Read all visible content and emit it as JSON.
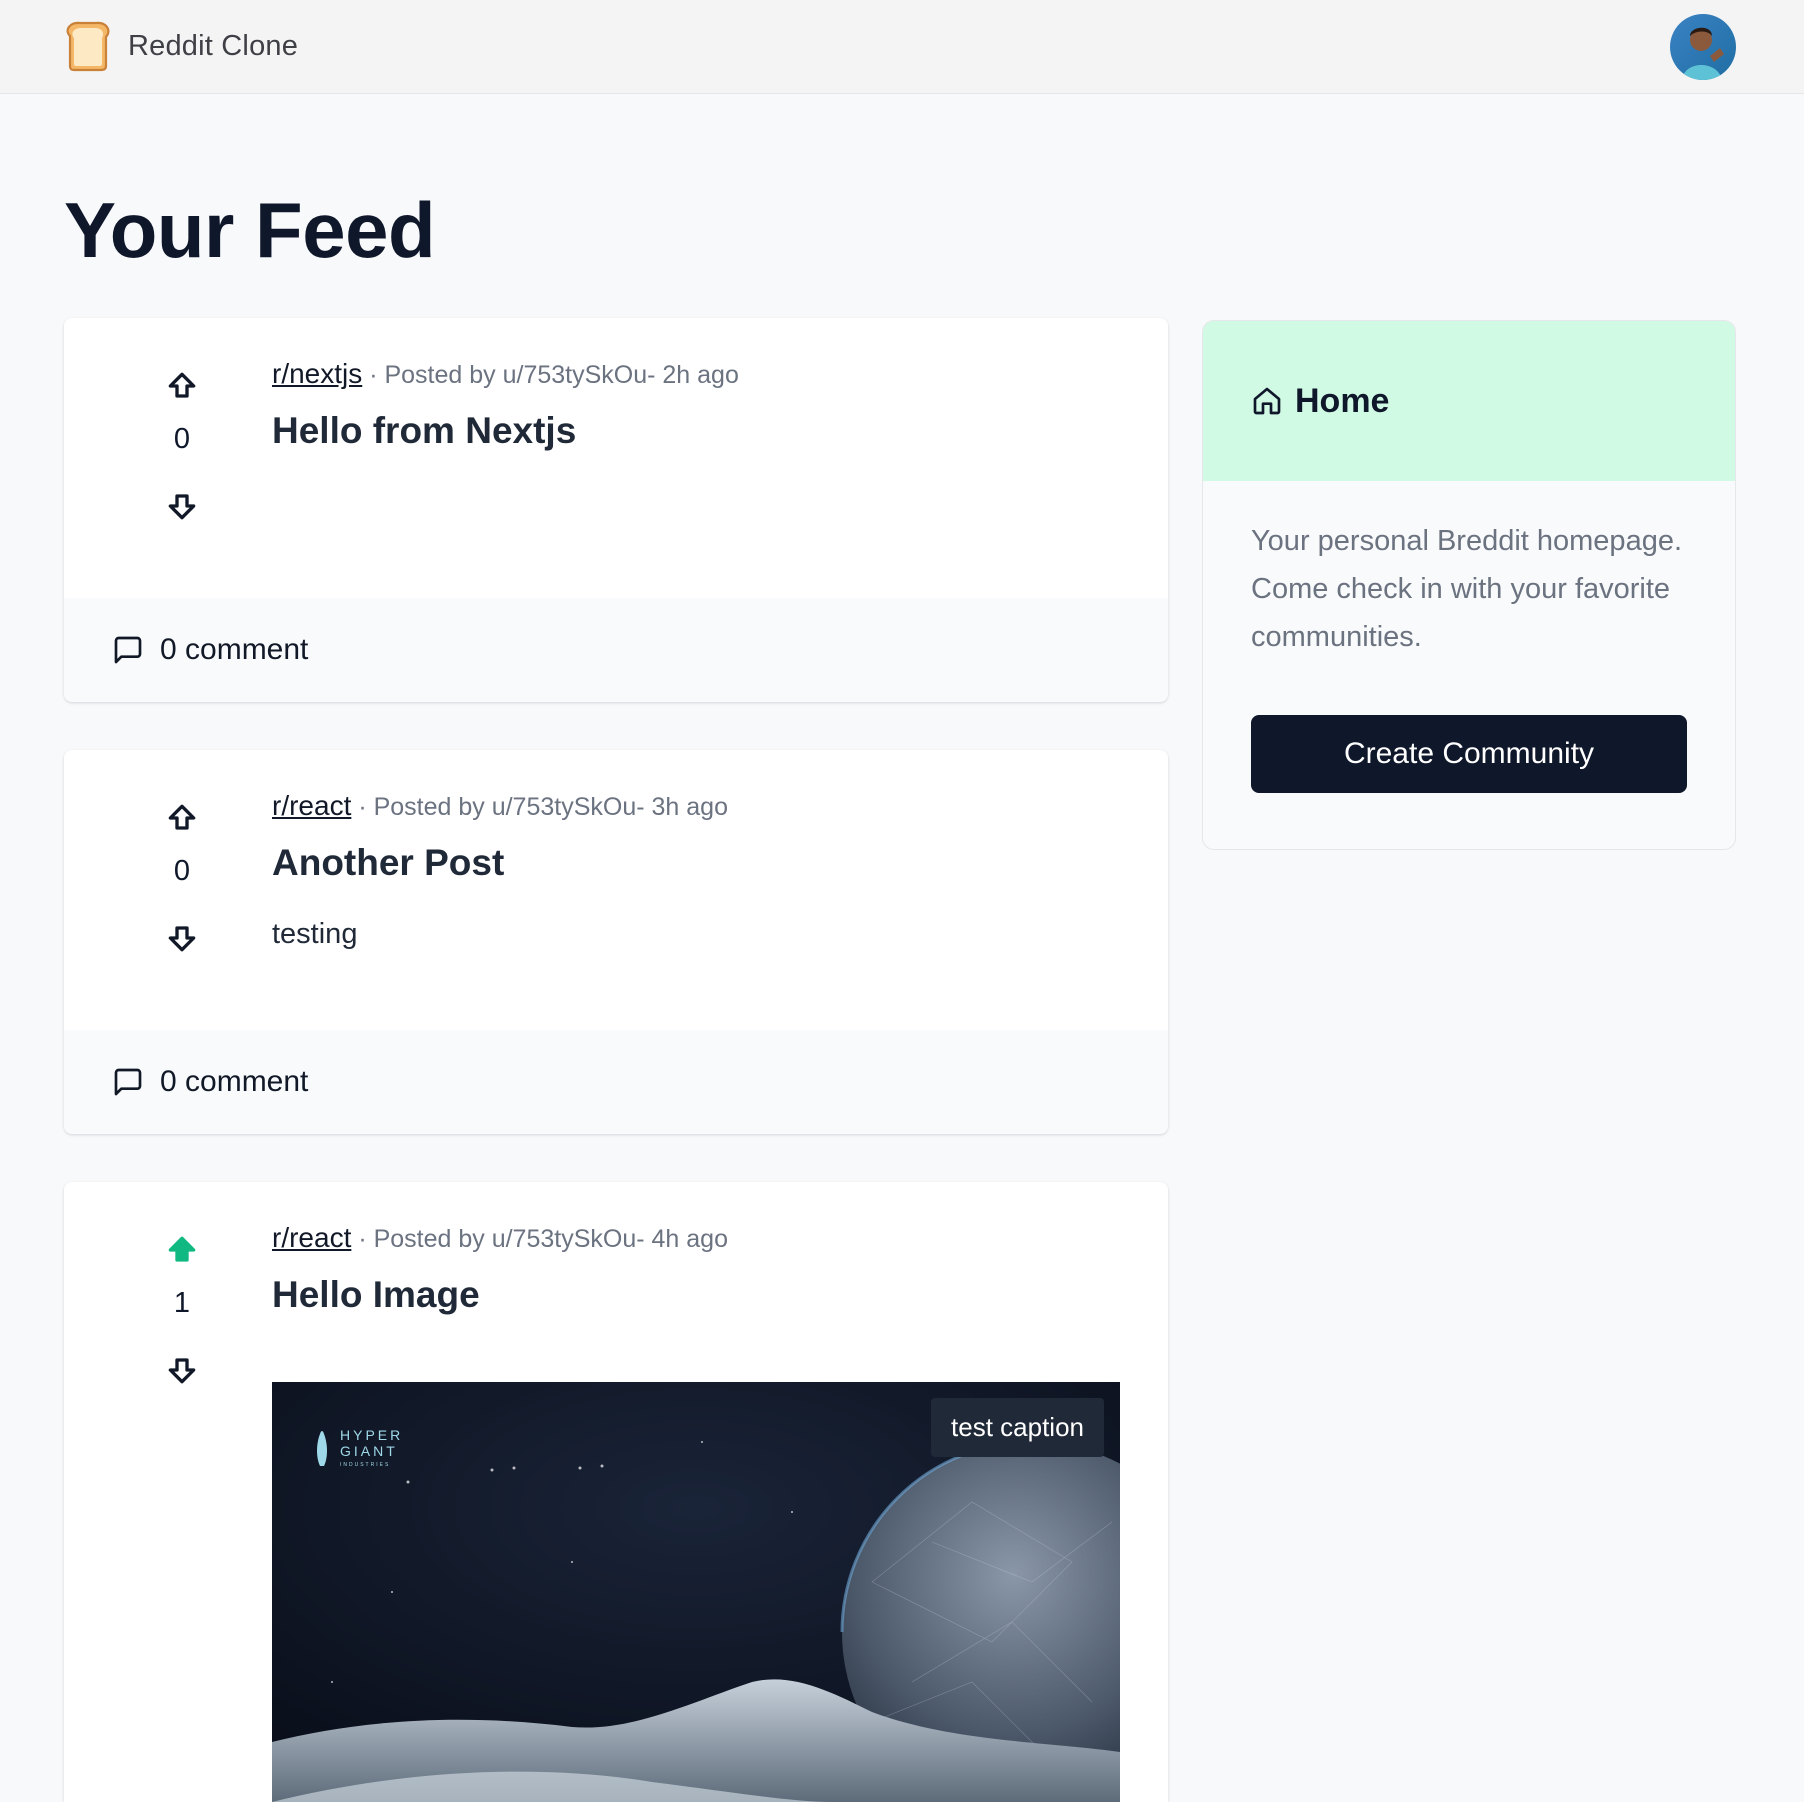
{
  "header": {
    "brand_name": "Reddit Clone",
    "logo_icon": "toast-bread-icon",
    "avatar": "user-avatar"
  },
  "page": {
    "title": "Your Feed"
  },
  "posts": [
    {
      "subreddit": "r/nextjs",
      "meta": "· Posted by u/753tySkOu- 2h ago",
      "title": "Hello from Nextjs",
      "text": "",
      "votes": "0",
      "upvoted": false,
      "comments": "0 comment"
    },
    {
      "subreddit": "r/react",
      "meta": "· Posted by u/753tySkOu- 3h ago",
      "title": "Another Post",
      "text": "testing",
      "votes": "0",
      "upvoted": false,
      "comments": "0 comment"
    },
    {
      "subreddit": "r/react",
      "meta": "· Posted by u/753tySkOu- 4h ago",
      "title": "Hello Image",
      "text": "",
      "votes": "1",
      "upvoted": true,
      "image_caption": "test caption",
      "image_logo_text_1": "HYPER",
      "image_logo_text_2": "GIANT",
      "image_logo_text_3": "INDUSTRIES"
    }
  ],
  "sidebar": {
    "title": "Home",
    "description": "Your personal Breddit homepage. Come check in with your favorite communities.",
    "create_button": "Create Community"
  },
  "colors": {
    "upvote_active": "#10b981",
    "sidebar_header_bg": "#d1fae5",
    "button_bg": "#0f172a"
  }
}
